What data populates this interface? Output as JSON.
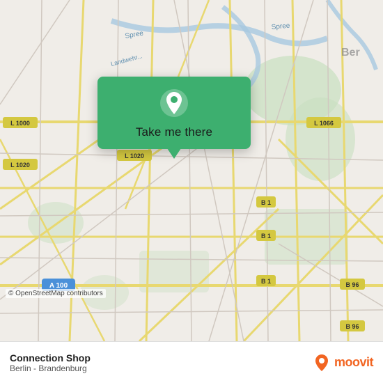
{
  "map": {
    "background_color": "#e8e0d8",
    "osm_credit": "© OpenStreetMap contributors"
  },
  "popup": {
    "label": "Take me there",
    "pin_icon": "location-pin"
  },
  "bottom_bar": {
    "location_name": "Connection Shop",
    "location_region": "Berlin - Brandenburg",
    "moovit_text": "moovit"
  }
}
